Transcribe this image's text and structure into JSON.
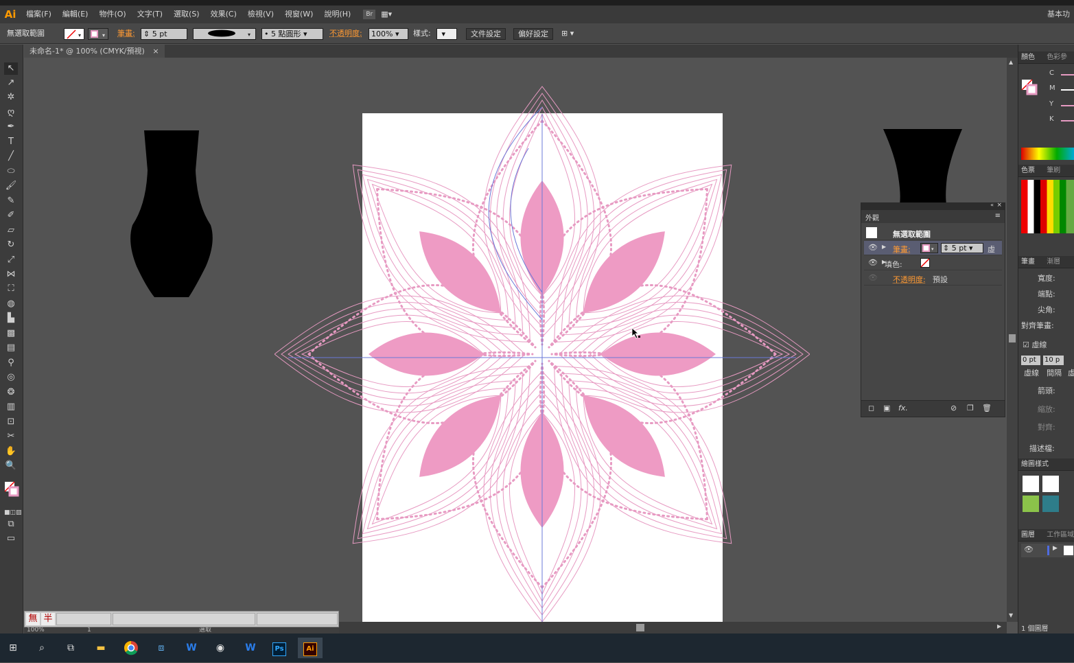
{
  "app": {
    "logo": "Ai",
    "workspace": "基本功"
  },
  "menu": [
    "檔案(F)",
    "編輯(E)",
    "物件(O)",
    "文字(T)",
    "選取(S)",
    "效果(C)",
    "檢視(V)",
    "視窗(W)",
    "說明(H)"
  ],
  "control": {
    "selection": "無選取範圍",
    "stroke_label": "筆畫:",
    "stroke_value": "5 pt",
    "brush": "5 點圓形",
    "opacity_label": "不透明度:",
    "opacity_value": "100%",
    "style_label": "樣式:",
    "doc_setup": "文件設定",
    "preferences": "偏好設定"
  },
  "document_tab": {
    "title": "未命名-1* @ 100% (CMYK/預視)",
    "close": "×"
  },
  "appearance": {
    "tab": "外觀",
    "header": "無選取範圍",
    "stroke_label": "筆畫:",
    "stroke_value": "5 pt",
    "stroke_extra": "虛",
    "fill_label": "填色:",
    "opacity_label": "不透明度:",
    "opacity_value": "預設"
  },
  "right_dock": {
    "color_tab": "顏色",
    "color_ref_tab": "色彩參",
    "cmyk": [
      "C",
      "M",
      "Y",
      "K"
    ],
    "swatches_tab": "色票",
    "brushes_tab": "筆刷",
    "stroke_tab": "筆畫",
    "gradient_tab": "漸層",
    "width_label": "寬度:",
    "cap_label": "端點:",
    "corner_label": "尖角:",
    "align_label": "對齊筆畫:",
    "dashed_label": "虛線",
    "dash_value": "0 pt",
    "gap_value": "10 p",
    "dash_caption": "虛線",
    "gap_caption": "間隔",
    "dash_caption_3": "虛",
    "arrow_label": "箭頭:",
    "scale_label": "縮放:",
    "align2_label": "對齊:",
    "profile_label": "描述檔:",
    "graphic_styles_tab": "繪圖樣式",
    "layers_tab": "圖層",
    "artboards_tab": "工作區域",
    "layers_count": "1 個圖層"
  },
  "status": {
    "zoom": "100%",
    "page": "1",
    "mode": "選取"
  },
  "ime": {
    "mode1": "無",
    "mode2": "半"
  },
  "colors": {
    "pink": "#ee9bc4",
    "pink_line": "#e79ac2",
    "guide": "#6a78d8"
  }
}
